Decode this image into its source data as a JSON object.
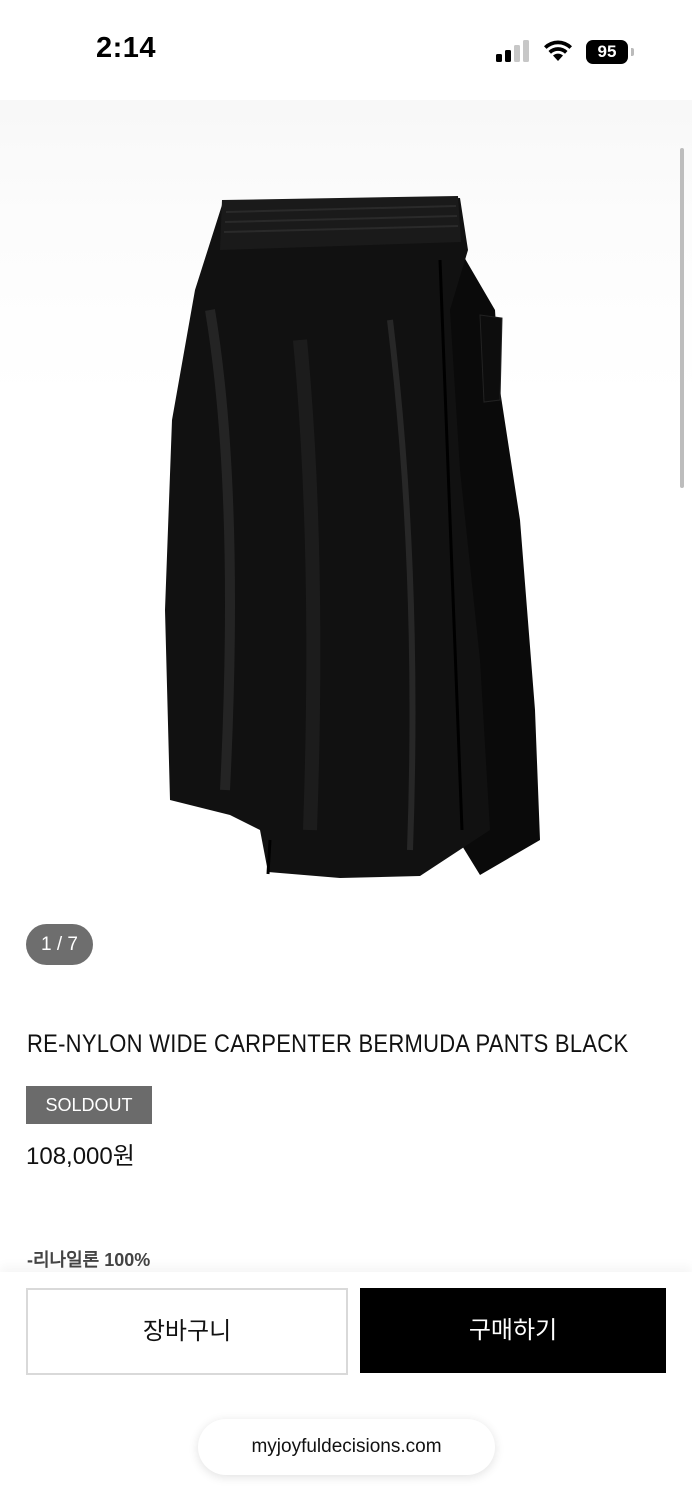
{
  "status_bar": {
    "time": "2:14",
    "battery": "95"
  },
  "gallery": {
    "indicator": "1 / 7"
  },
  "product": {
    "title": "RE-NYLON WIDE CARPENTER BERMUDA PANTS BLACK",
    "badge": "SOLDOUT",
    "price": "108,000원",
    "material": "-리나일론 100%"
  },
  "actions": {
    "cart_label": "장바구니",
    "buy_label": "구매하기"
  },
  "browser": {
    "url": "myjoyfuldecisions.com"
  },
  "colors": {
    "badge_bg": "#6b6b6b",
    "buy_bg": "#000000",
    "page_bg": "#ffffff"
  }
}
